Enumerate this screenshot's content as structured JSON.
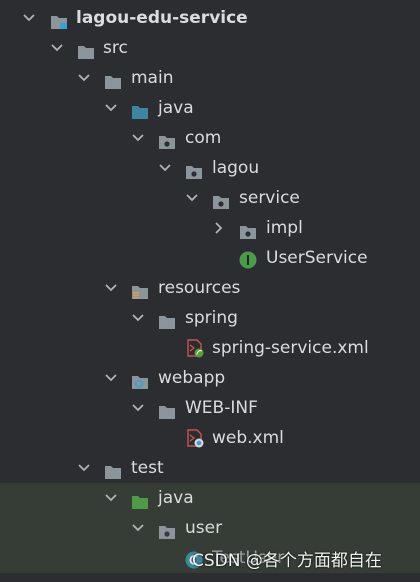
{
  "tree": {
    "project": "lagou-edu-service",
    "src": "src",
    "main": "main",
    "java": "java",
    "com": "com",
    "lagou": "lagou",
    "service": "service",
    "impl": "impl",
    "user_service": "UserService",
    "resources": "resources",
    "spring": "spring",
    "spring_service_xml": "spring-service.xml",
    "webapp": "webapp",
    "web_inf": "WEB-INF",
    "web_xml": "web.xml",
    "test": "test",
    "test_java": "java",
    "user": "user",
    "test_file": "TestUser"
  },
  "watermark": "CSDN @各个方面都自在",
  "icons": {
    "folder": "folder-icon",
    "source_folder": "source-folder-icon",
    "package": "package-icon",
    "resources_folder": "resources-folder-icon",
    "web_folder": "web-folder-icon",
    "test_folder": "test-folder-icon",
    "interface": "interface-icon",
    "spring_xml": "spring-xml-icon",
    "web_xml": "web-xml-icon",
    "java_class": "java-class-icon"
  },
  "colors": {
    "background": "#2b2d30",
    "folder": "#8c949c",
    "source_folder": "#3e86a0",
    "test_folder": "#4f9a48",
    "interface_badge": "#4d9a4d",
    "text": "#dcdcdc"
  }
}
